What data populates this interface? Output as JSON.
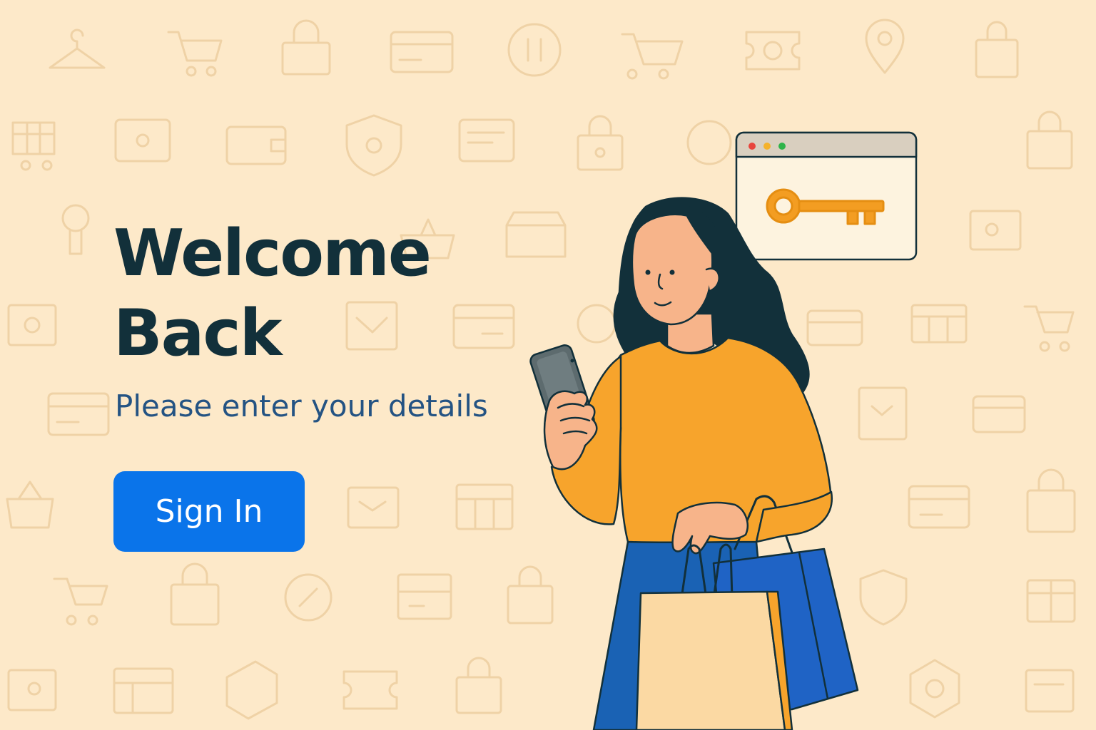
{
  "hero": {
    "title_line1": "Welcome",
    "title_line2": "Back",
    "subtitle": "Please enter your details"
  },
  "actions": {
    "sign_in_label": "Sign In"
  },
  "colors": {
    "background": "#fde9c9",
    "title": "#12303a",
    "subtitle": "#245383",
    "button": "#0a74ea",
    "button_text": "#ffffff",
    "sweater": "#f7a42c",
    "key": "#f39d22",
    "bag_blue": "#1f63c5",
    "bag_tan": "#fbd9a3"
  },
  "icons": {
    "background_pattern": "shopping-icons-pattern",
    "browser_key": "key-icon"
  }
}
